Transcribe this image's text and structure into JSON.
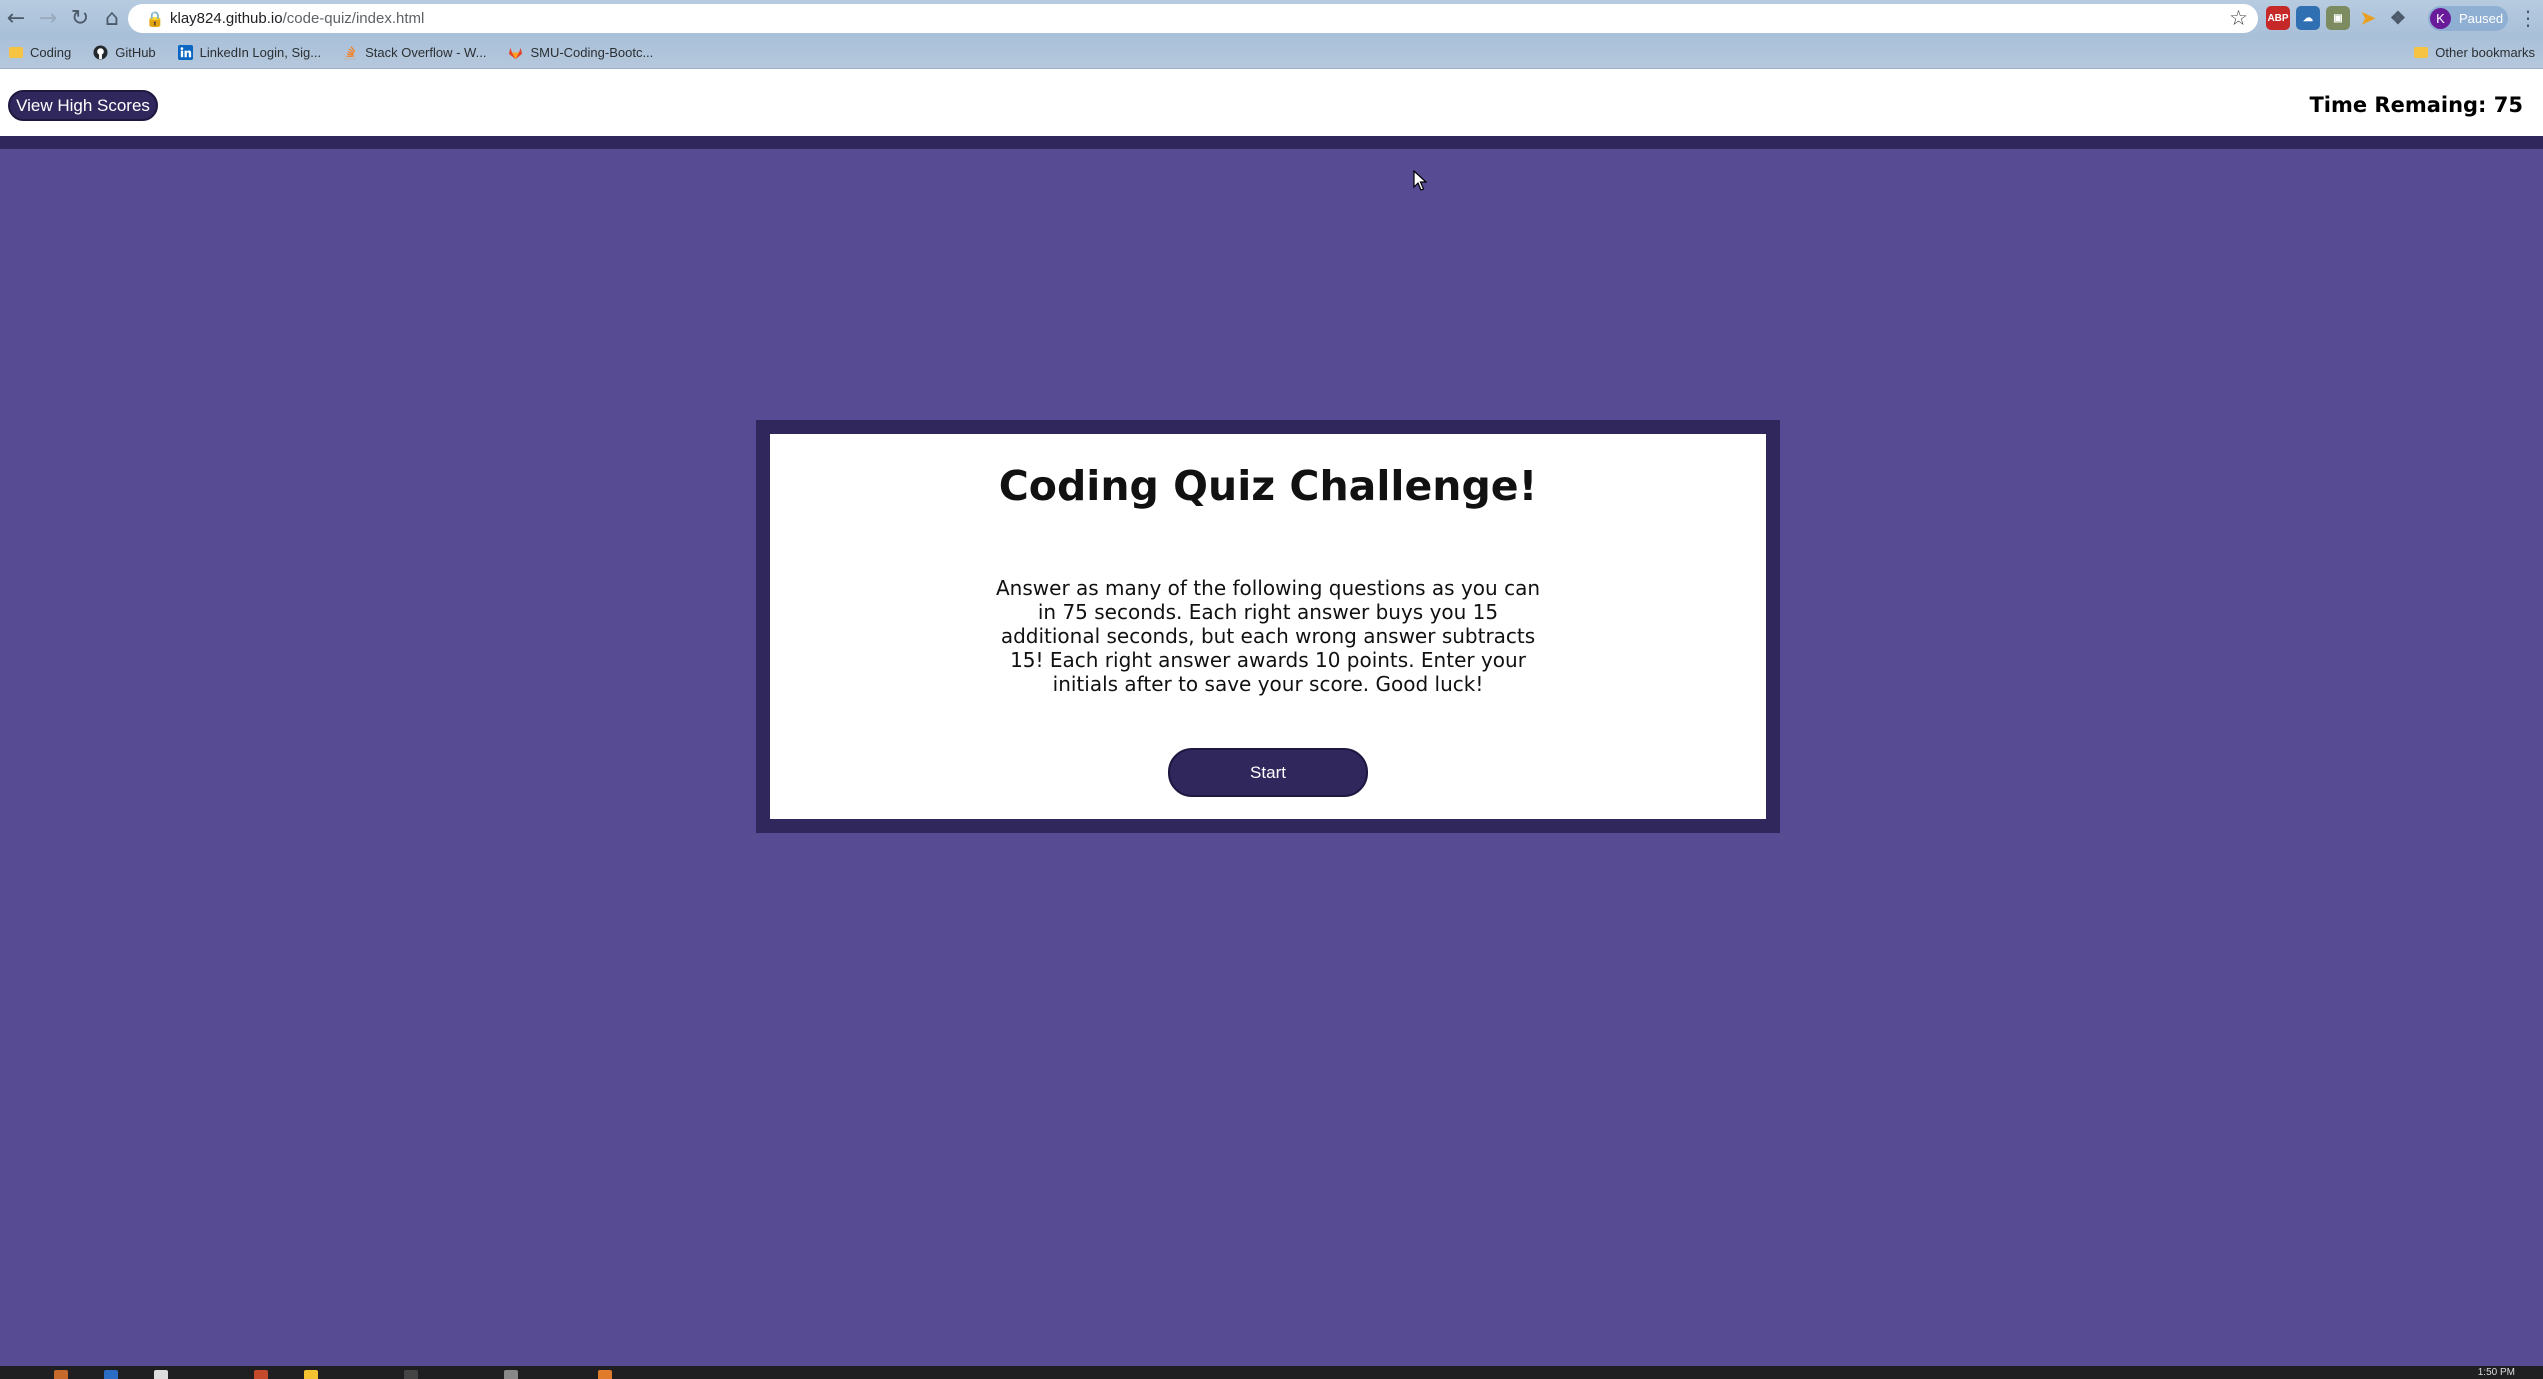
{
  "browser": {
    "url_host": "klay824.github.io",
    "url_path": "/code-quiz/index.html",
    "nav": {
      "back_icon": "arrow-left",
      "forward_icon": "arrow-right",
      "reload_icon": "reload",
      "home_icon": "home"
    },
    "extensions": {
      "abp_label": "ABP"
    },
    "profile": {
      "initial": "K",
      "status": "Paused"
    },
    "bookmarks": [
      {
        "label": "Coding",
        "icon": "folder-icon"
      },
      {
        "label": "GitHub",
        "icon": "github-icon"
      },
      {
        "label": "LinkedIn Login, Sig...",
        "icon": "linkedin-icon"
      },
      {
        "label": "Stack Overflow - W...",
        "icon": "stackoverflow-icon"
      },
      {
        "label": "SMU-Coding-Bootc...",
        "icon": "gitlab-icon"
      }
    ],
    "other_bookmarks": "Other bookmarks"
  },
  "header": {
    "high_scores_label": "View High Scores",
    "timer_text": "Time Remaing: 75"
  },
  "quiz": {
    "title": "Coding Quiz Challenge!",
    "instructions": "Answer as many of the following questions as you can in 75 seconds. Each right answer buys you 15 additional seconds, but each wrong answer subtracts 15! Each right answer awards 10 points. Enter your initials after to save your score. Good luck!",
    "start_label": "Start"
  },
  "taskbar": {
    "clock": "1:50 PM"
  },
  "colors": {
    "page_background": "#574c94",
    "accent_dark": "#30285c",
    "card_background": "#ffffff"
  }
}
